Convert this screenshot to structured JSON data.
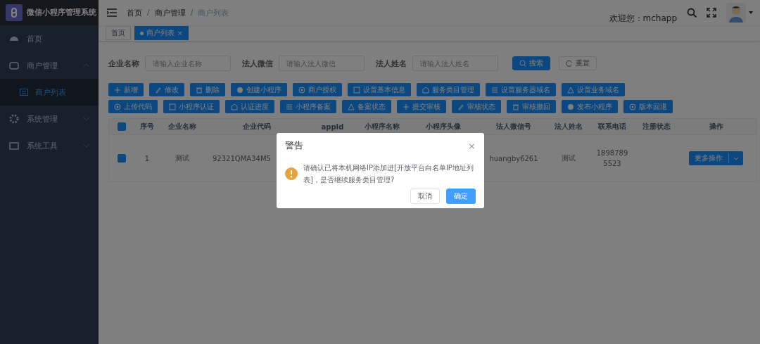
{
  "sidebar": {
    "title": "微信小程序管理系统",
    "items": [
      {
        "label": "首页",
        "kind": "link",
        "selected": false
      },
      {
        "label": "商户管理",
        "kind": "group",
        "expanded": true,
        "selected": false,
        "children": [
          {
            "label": "商户列表",
            "selected": true
          }
        ]
      },
      {
        "label": "系统管理",
        "kind": "group",
        "expanded": false,
        "selected": false
      },
      {
        "label": "系统工具",
        "kind": "group",
        "expanded": false,
        "selected": false
      }
    ]
  },
  "navbar": {
    "breadcrumb": [
      "首页",
      "商户管理",
      "商户列表"
    ],
    "separator": "/",
    "welcome": "欢迎您：mchapp"
  },
  "tags": [
    {
      "label": "首页",
      "selected": false
    },
    {
      "label": "商户列表",
      "selected": true,
      "close": "×"
    }
  ],
  "search": {
    "fields": [
      {
        "label": "企业名称",
        "placeholder": "请输入企业名称"
      },
      {
        "label": "法人微信",
        "placeholder": "请输入法人微信"
      },
      {
        "label": "法人姓名",
        "placeholder": "请输入法人姓名"
      }
    ],
    "buttons": [
      {
        "label": "搜索",
        "kind": "primary"
      },
      {
        "label": "重置",
        "kind": "plain"
      }
    ]
  },
  "toolbar": [
    [
      "新增",
      "修改",
      "删除",
      "创建小程序",
      "商户授权",
      "设置基本信息",
      "服务类目管理",
      "设置服务器域名",
      "设置业务域名"
    ],
    [
      "上传代码",
      "小程序认证",
      "认证进度",
      "小程序备案",
      "备案状态",
      "提交审核",
      "审核状态",
      "审核撤回",
      "发布小程序",
      "版本回退"
    ]
  ],
  "table": {
    "columns": [
      "序号",
      "企业名称",
      "企业代码",
      "appId",
      "小程序名称",
      "小程序头像",
      "法人微信号",
      "法人姓名",
      "联系电话",
      "注册状态",
      "操作"
    ],
    "header_checked": true,
    "rows": [
      {
        "checked": true,
        "cells": [
          "1",
          "测试",
          "92321QMA34M5",
          "",
          "",
          "",
          "huangby6261",
          "测试",
          "18987895523",
          ""
        ],
        "action": "更多操作"
      }
    ]
  },
  "dialog": {
    "title": "警告",
    "close": "×",
    "message": "请确认已将本机网络IP添加进[开放平台白名单IP地址列表]，是否继续服务类目管理?",
    "buttons": [
      {
        "label": "取消",
        "kind": "plain"
      },
      {
        "label": "确定",
        "kind": "primary"
      }
    ]
  }
}
